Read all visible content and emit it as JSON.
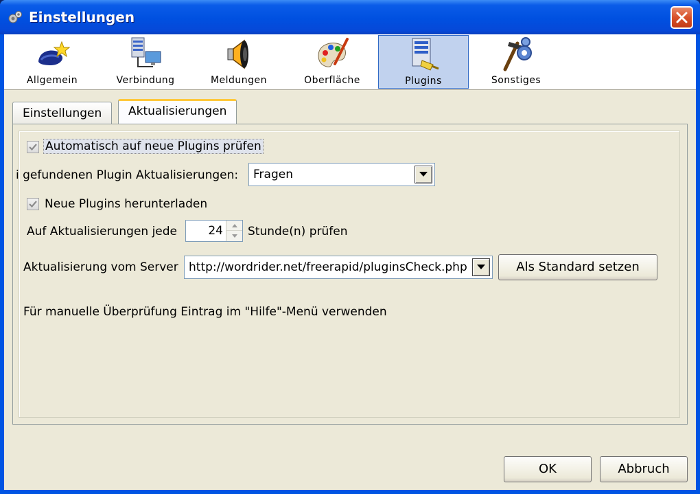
{
  "window": {
    "title": "Einstellungen"
  },
  "toolbar": {
    "items": [
      {
        "label": "Allgemein",
        "icon": "general-icon",
        "selected": false
      },
      {
        "label": "Verbindung",
        "icon": "connection-icon",
        "selected": false
      },
      {
        "label": "Meldungen",
        "icon": "speaker-icon",
        "selected": false
      },
      {
        "label": "Oberfläche",
        "icon": "palette-icon",
        "selected": false
      },
      {
        "label": "Plugins",
        "icon": "plugins-icon",
        "selected": true
      },
      {
        "label": "Sonstiges",
        "icon": "tools-icon",
        "selected": false
      }
    ]
  },
  "tabs": [
    {
      "label": "Einstellungen",
      "active": false
    },
    {
      "label": "Aktualisierungen",
      "active": true
    }
  ],
  "panel": {
    "auto_check": {
      "label": "Automatisch auf neue Plugins prüfen",
      "checked": true
    },
    "on_found": {
      "label": "i gefundenen Plugin Aktualisierungen:",
      "value": "Fragen"
    },
    "download_new": {
      "label": "Neue Plugins herunterladen",
      "checked": true
    },
    "interval": {
      "label_before": "Auf Aktualisierungen jede",
      "value": "24",
      "label_after": "Stunde(n) prüfen"
    },
    "server": {
      "label": "Aktualisierung vom Server",
      "value": "http://wordrider.net/freerapid/pluginsCheck.php",
      "default_button": "Als Standard setzen"
    },
    "hint": "Für manuelle Überprüfung Eintrag im \"Hilfe\"-Menü verwenden"
  },
  "buttons": {
    "ok": "OK",
    "cancel": "Abbruch"
  },
  "colors": {
    "title_bar": "#0054e3",
    "close_button": "#d8512b",
    "selection": "#c1d2ee",
    "tab_highlight": "#ffc83c"
  }
}
